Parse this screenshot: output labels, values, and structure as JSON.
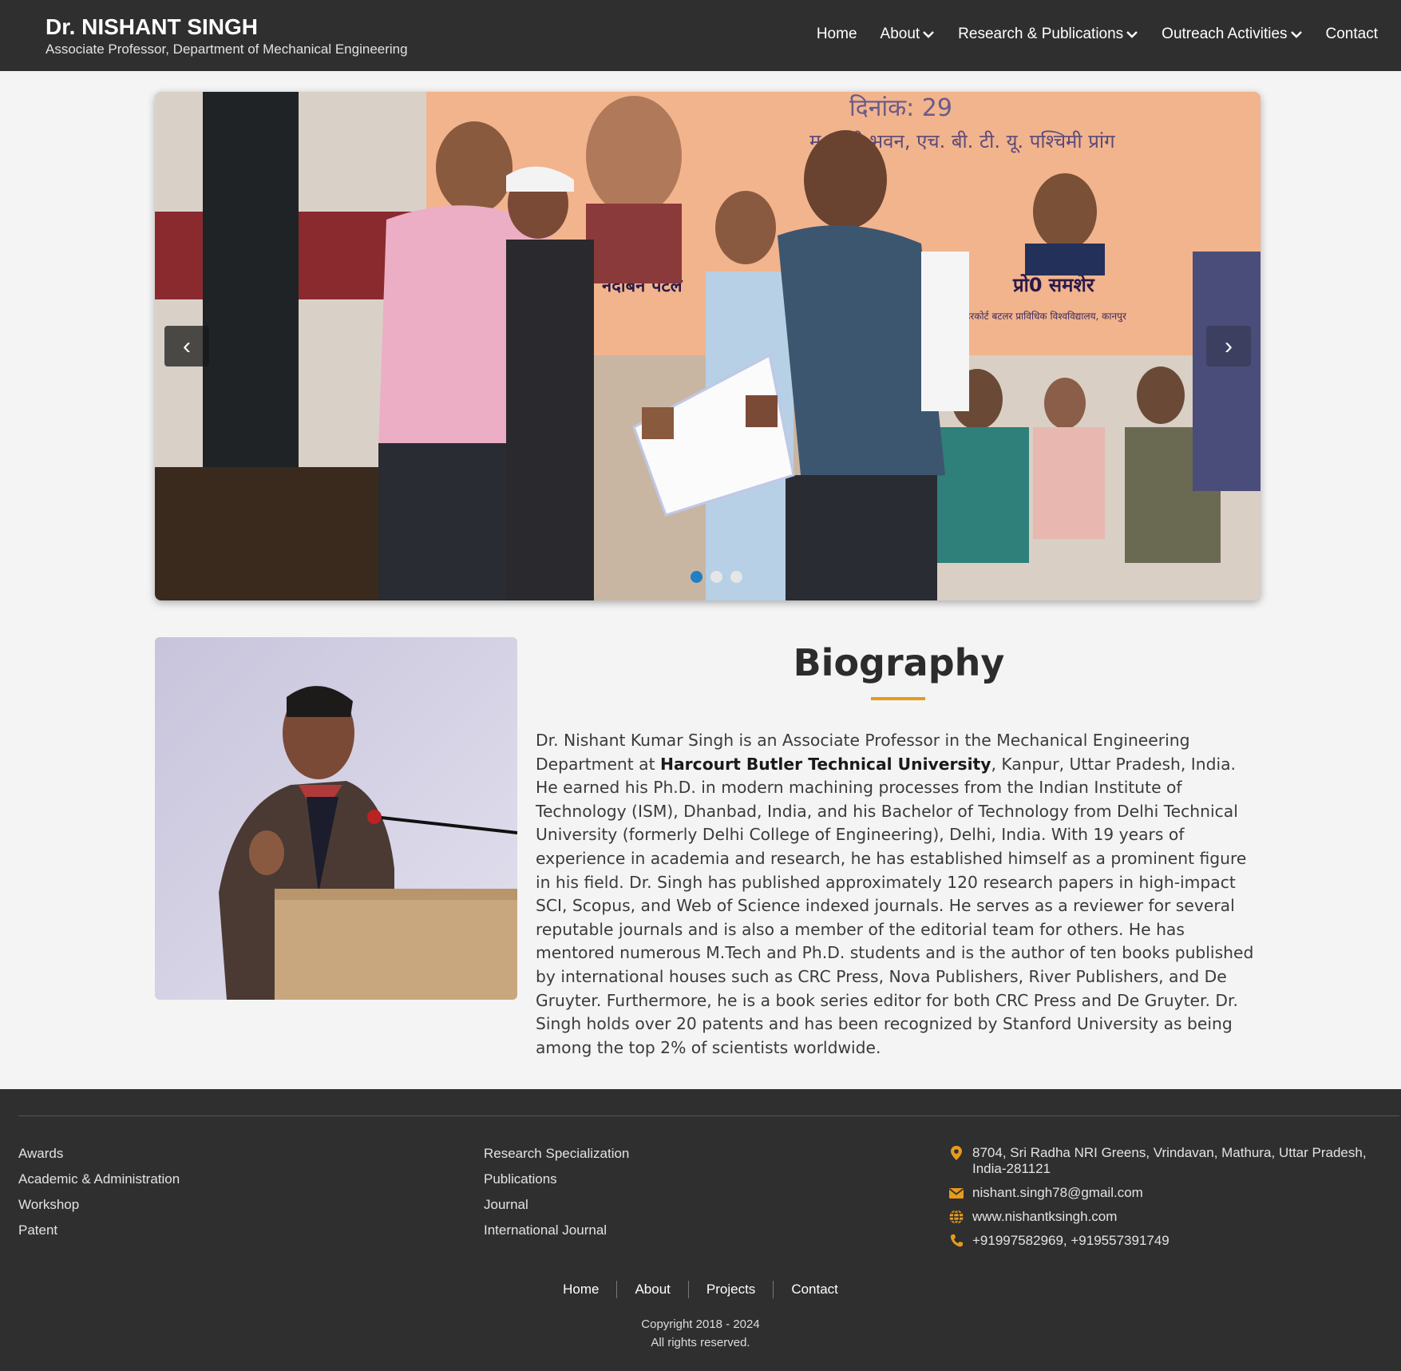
{
  "header": {
    "name": "Dr. NISHANT SINGH",
    "subtitle": "Associate Professor, Department of Mechanical Engineering",
    "nav": [
      {
        "label": "Home",
        "dropdown": false
      },
      {
        "label": "About",
        "dropdown": true
      },
      {
        "label": "Research & Publications",
        "dropdown": true
      },
      {
        "label": "Outreach Activities",
        "dropdown": true
      },
      {
        "label": "Contact",
        "dropdown": false
      }
    ]
  },
  "carousel": {
    "prev_label": "‹",
    "next_label": "›",
    "slide_count": 3,
    "active_slide": 1,
    "banner_text_1": "दिनांक: 29",
    "banner_text_2": "म्…ल्दी भवन, एच. बी. टी. यू. पश्चिमी प्रांग",
    "banner_text_3": "नंदीबेन पटेल",
    "banner_text_4": "प्रो0 समशेर",
    "banner_text_5": "हरकोर्ट बटलर प्राविधिक विश्वविद्यालय, कानपुर"
  },
  "biography": {
    "title": "Biography",
    "text_before": "Dr. Nishant Kumar Singh is an Associate Professor in the Mechanical Engineering Department at ",
    "text_bold": "Harcourt Butler Technical University",
    "text_after": ", Kanpur, Uttar Pradesh, India. He earned his Ph.D. in modern machining processes from the Indian Institute of Technology (ISM), Dhanbad, India, and his Bachelor of Technology from Delhi Technical University (formerly Delhi College of Engineering), Delhi, India. With 19 years of experience in academia and research, he has established himself as a prominent figure in his field. Dr. Singh has published approximately 120 research papers in high-impact SCI, Scopus, and Web of Science indexed journals. He serves as a reviewer for several reputable journals and is also a member of the editorial team for others. He has mentored numerous M.Tech and Ph.D. students and is the author of ten books published by international houses such as CRC Press, Nova Publishers, River Publishers, and De Gruyter. Furthermore, he is a book series editor for both CRC Press and De Gruyter. Dr. Singh holds over 20 patents and has been recognized by Stanford University as being among the top 2% of scientists worldwide."
  },
  "footer": {
    "col1": [
      "Awards",
      "Academic & Administration",
      "Workshop",
      "Patent"
    ],
    "col2": [
      "Research Specialization",
      "Publications",
      "Journal",
      "International Journal"
    ],
    "contact": {
      "address": "8704, Sri Radha NRI Greens, Vrindavan, Mathura, Uttar Pradesh, India-281121",
      "email": "nishant.singh78@gmail.com",
      "website": "www.nishantksingh.com",
      "phone": "+91997582969, +919557391749"
    },
    "bottom_nav": [
      "Home",
      "About",
      "Projects",
      "Contact"
    ],
    "copyright": "Copyright 2018 - 2024",
    "rights": "All rights reserved.",
    "accent_color": "#e69b1c"
  }
}
